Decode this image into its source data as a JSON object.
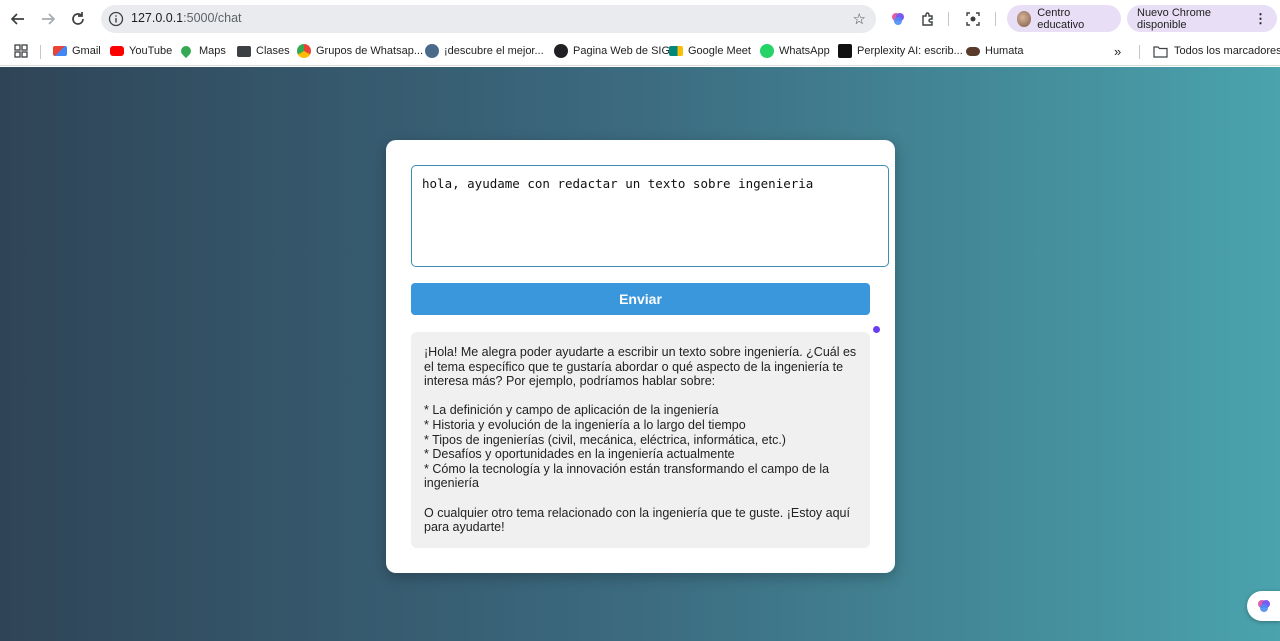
{
  "browser": {
    "url_host": "127.0.0.1",
    "url_path": ":5000/chat",
    "profile_chip": "Centro educativo",
    "update_chip": "Nuevo Chrome disponible",
    "bookmarks": [
      {
        "label": "Gmail",
        "icon": "gmail-icon",
        "color": "#ea4335"
      },
      {
        "label": "YouTube",
        "icon": "youtube-icon",
        "color": "#ff0000"
      },
      {
        "label": "Maps",
        "icon": "maps-icon",
        "color": "#34a853"
      },
      {
        "label": "Clases",
        "icon": "classroom-icon",
        "color": "#3c4043"
      },
      {
        "label": "Grupos de Whatsap...",
        "icon": "chrome-icon",
        "color": "#fbbc04"
      },
      {
        "label": "¡descubre el mejor...",
        "icon": "globe-icon",
        "color": "#4a6a8a"
      },
      {
        "label": "Pagina Web de SIG",
        "icon": "globe-icon",
        "color": "#202124"
      },
      {
        "label": "Google Meet",
        "icon": "meet-icon",
        "color": "#00897b"
      },
      {
        "label": "WhatsApp",
        "icon": "whatsapp-icon",
        "color": "#25d366"
      },
      {
        "label": "Perplexity AI: escrib...",
        "icon": "perplexity-icon",
        "color": "#111111"
      },
      {
        "label": "Humata",
        "icon": "humata-icon",
        "color": "#5a3a2a"
      }
    ],
    "all_bookmarks": "Todos los marcadores"
  },
  "chat": {
    "input_value": "hola, ayudame con redactar un texto sobre ingenieria",
    "send_label": "Enviar",
    "response_paragraphs": [
      "¡Hola! Me alegra poder ayudarte a escribir un texto sobre ingeniería. ¿Cuál es el tema específico que te gustaría abordar o qué aspecto de la ingeniería te interesa más? Por ejemplo, podríamos hablar sobre:",
      "",
      "* La definición y campo de aplicación de la ingeniería",
      "* Historia y evolución de la ingeniería a lo largo del tiempo",
      "* Tipos de ingenierías (civil, mecánica, eléctrica, informática, etc.)",
      "* Desafíos y oportunidades en la ingeniería actualmente",
      "* Cómo la tecnología y la innovación están transformando el campo de la ingeniería",
      "",
      "O cualquier otro tema relacionado con la ingeniería que te guste. ¡Estoy aquí para ayudarte!"
    ]
  },
  "colors": {
    "accent_button": "#3a97dc",
    "gradient_start": "#2f4457",
    "gradient_end": "#4aa3ad"
  }
}
